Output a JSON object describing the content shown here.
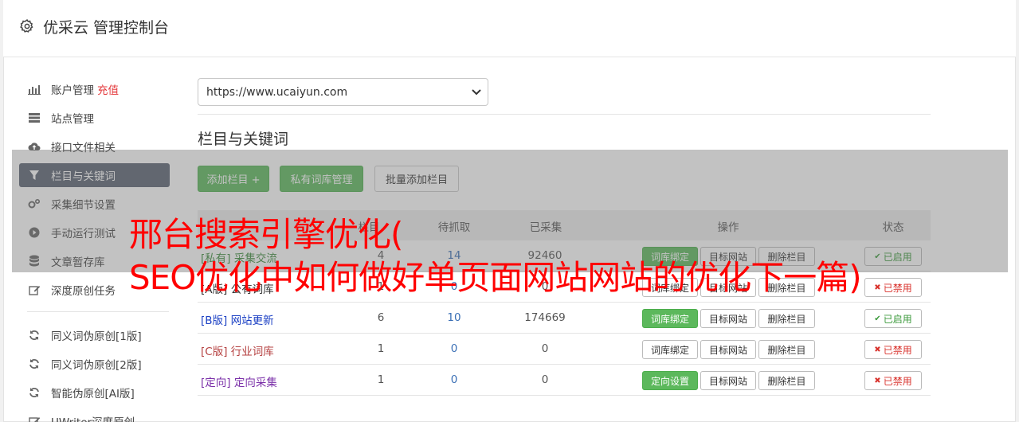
{
  "header": {
    "title": "优采云 管理控制台",
    "icon": "gear-icon"
  },
  "sidebar": {
    "items": [
      {
        "label": "账户管理",
        "extra": "充值",
        "icon": "bar-chart-icon"
      },
      {
        "label": "站点管理",
        "icon": "server-icon"
      },
      {
        "label": "接口文件相关",
        "icon": "cloud-upload-icon"
      },
      {
        "label": "栏目与关键词",
        "icon": "filter-icon",
        "active": true
      },
      {
        "label": "采集细节设置",
        "icon": "cogs-icon"
      },
      {
        "label": "手动运行测试",
        "icon": "play-circle-icon"
      },
      {
        "label": "文章暂存库",
        "icon": "database-icon"
      },
      {
        "label": "深度原创任务",
        "icon": "edit-icon"
      },
      {
        "label": "同义词伪原创[1版]",
        "icon": "refresh-icon"
      },
      {
        "label": "同义词伪原创[2版]",
        "icon": "refresh-icon"
      },
      {
        "label": "智能伪原创[AI版]",
        "icon": "refresh-icon"
      },
      {
        "label": "UWriter深度原创",
        "icon": "edit-icon"
      }
    ]
  },
  "main": {
    "site_select": "https://www.ucaiyun.com",
    "section_title": "栏目与关键词",
    "buttons": {
      "add": "添加栏目 +",
      "private": "私有词库管理",
      "batch": "批量添加栏目"
    }
  },
  "table": {
    "headers": {
      "name": "栏目",
      "wait": "待抓取",
      "collected": "已采集",
      "ops": "操作",
      "status": "状态"
    },
    "rows": [
      {
        "tag": "[私有]",
        "name": "采集交流",
        "count": "4",
        "wait": "14",
        "collected": "92460",
        "op1": "词库绑定",
        "op2": "目标网站",
        "op3": "删除栏目",
        "status": "已启用",
        "status_on": true,
        "color": "#3c8c3c"
      },
      {
        "tag": "[A版]",
        "name": "公有词库",
        "count": "1",
        "wait": "0",
        "collected": "0",
        "op1": "词库绑定",
        "op2": "目标网站",
        "op3": "删除栏目",
        "status": "已禁用",
        "status_on": false,
        "color": "#333333"
      },
      {
        "tag": "[B版]",
        "name": "网站更新",
        "count": "6",
        "wait": "10",
        "collected": "174669",
        "op1": "词库绑定",
        "op2": "目标网站",
        "op3": "删除栏目",
        "status": "已启用",
        "status_on": true,
        "color": "#1a3fc4"
      },
      {
        "tag": "[C版]",
        "name": "行业词库",
        "count": "1",
        "wait": "0",
        "collected": "0",
        "op1": "词库绑定",
        "op2": "目标网站",
        "op3": "删除栏目",
        "status": "已禁用",
        "status_on": false,
        "color": "#b54040"
      },
      {
        "tag": "[定向]",
        "name": "定向采集",
        "count": "1",
        "wait": "0",
        "collected": "0",
        "op1": "定向设置",
        "op2": "目标网站",
        "op3": "删除栏目",
        "status": "已禁用",
        "status_on": false,
        "color": "#7a2fa8"
      }
    ]
  },
  "overlay": {
    "line1": "邢台搜索引擎优化(",
    "line2": "SEO优化中如何做好单页面网站网站的优化下一篇)"
  },
  "colors": {
    "accent_green": "#5cb85c",
    "active_nav": "#5a6272",
    "headline_red": "#ff0000"
  }
}
